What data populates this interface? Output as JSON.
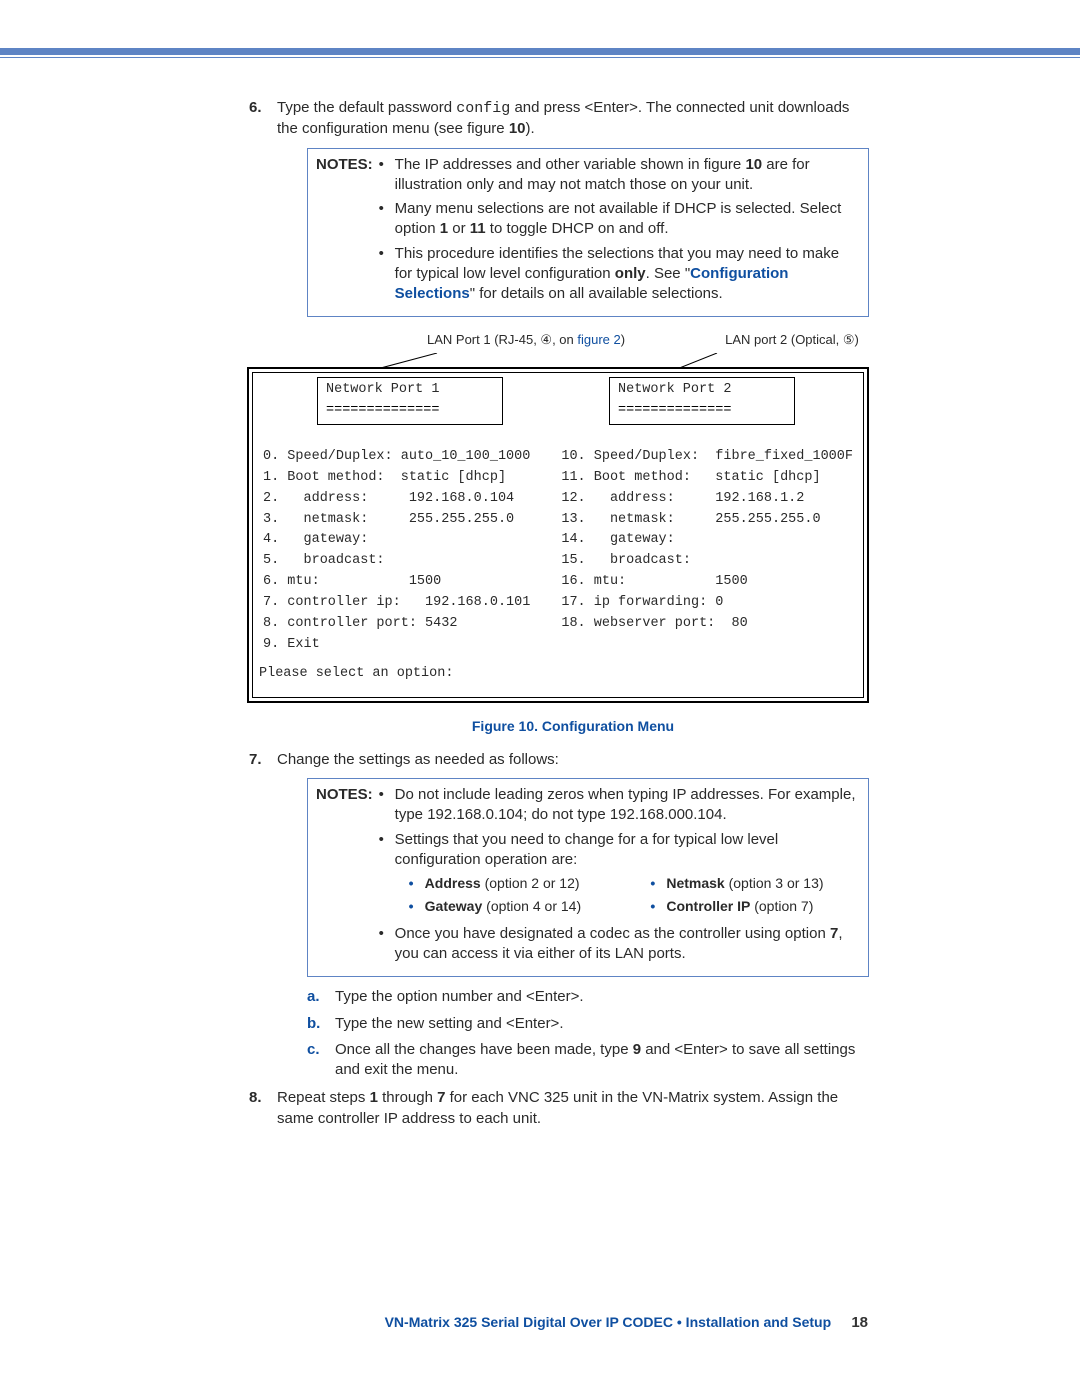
{
  "step6": {
    "num": "6.",
    "pre": "Type the default password ",
    "pw": "config",
    "mid": " and press <Enter>. The connected unit downloads the configuration menu (see figure ",
    "figref": "10",
    "post": ")."
  },
  "notes1": {
    "label": "NOTES:",
    "items": [
      {
        "pre": "The IP addresses and other variable shown in figure ",
        "b1": "10",
        "post": " are for illustration only and may not match those on your unit."
      },
      {
        "pre": "Many menu selections are not available if DHCP is selected. Select option ",
        "b1": "1",
        "mid": " or ",
        "b2": "11",
        "post": " to toggle DHCP on and off."
      },
      {
        "pre": "This procedure identifies the selections that you may need to make for typical low level configuration ",
        "b1": "only",
        "mid": ". See \"",
        "link": "Configuration Selections",
        "post": "\" for details on all available selections."
      }
    ]
  },
  "leaders": {
    "l1a": "LAN Port 1 (RJ-45, ④, on ",
    "l1b": "figure 2",
    "l1c": ")",
    "l2": "LAN port 2 (Optical, ⑤)"
  },
  "term": {
    "head1": {
      "title": "Network Port 1",
      "rule": "=============="
    },
    "head2": {
      "title": "Network Port 2",
      "rule": "=============="
    },
    "col1": "0. Speed/Duplex: auto_10_100_1000\n1. Boot method:  static [dhcp]\n2.   address:     192.168.0.104\n3.   netmask:     255.255.255.0\n4.   gateway:\n5.   broadcast:\n6. mtu:           1500\n7. controller ip:   192.168.0.101\n8. controller port: 5432\n9. Exit",
    "col2": "10. Speed/Duplex:  fibre_fixed_1000F\n11. Boot method:   static [dhcp]\n12.   address:     192.168.1.2\n13.   netmask:     255.255.255.0\n14.   gateway:\n15.   broadcast:\n16. mtu:           1500\n17. ip forwarding: 0\n18. webserver port:  80",
    "footer": "Please select an option:"
  },
  "figcap": "Figure 10.  Configuration Menu",
  "step7": {
    "num": "7.",
    "text": "Change the settings as needed as follows:"
  },
  "notes2": {
    "label": "NOTES:",
    "items": [
      "Do not include leading zeros when typing IP addresses. For example, type 192.168.0.104; do not type 192.168.000.104.",
      "Settings that you need to change for a for typical low level configuration operation are:"
    ],
    "deep": [
      {
        "b": "Address",
        "rest": " (option 2 or 12)"
      },
      {
        "b": "Gateway",
        "rest": " (option 4 or 14)"
      },
      {
        "b": "Netmask",
        "rest": " (option 3 or 13)"
      },
      {
        "b": "Controller IP",
        "rest": " (option 7)"
      }
    ],
    "last": {
      "pre": "Once you have designated a codec as the controller using option ",
      "b": "7",
      "post": ", you can access it via either of its LAN ports."
    }
  },
  "substeps": [
    {
      "let": "a.",
      "text": "Type the option number and <Enter>."
    },
    {
      "let": "b.",
      "text": "Type the new setting and <Enter>."
    },
    {
      "let": "c.",
      "pre": "Once all the changes have been made, type ",
      "b": "9",
      "post": " and <Enter> to save all settings and exit the menu."
    }
  ],
  "step8": {
    "num": "8.",
    "pre": "Repeat steps ",
    "b1": "1",
    "mid": " through ",
    "b2": "7",
    "post": " for each VNC 325 unit in the VN-Matrix system. Assign the same controller IP address to each unit."
  },
  "footer": {
    "title": "VN-Matrix 325 Serial Digital Over IP CODEC • Installation and Setup",
    "page": "18"
  }
}
